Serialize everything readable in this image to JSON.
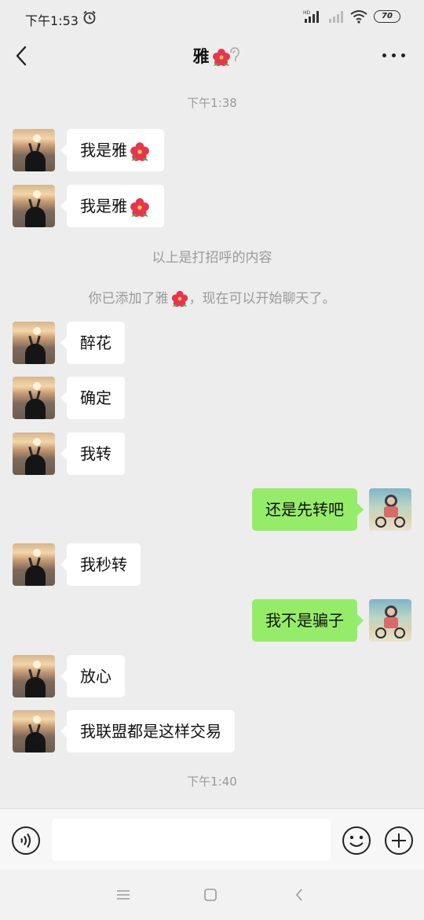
{
  "status_bar": {
    "time": "下午1:53",
    "battery": "70"
  },
  "header": {
    "title": "雅"
  },
  "timestamps": [
    "下午1:38",
    "下午1:40"
  ],
  "system_messages": [
    "以上是打招呼的内容",
    "你已添加了雅",
    "，现在可以开始聊天了。"
  ],
  "messages": [
    {
      "side": "left",
      "text": "我是雅"
    },
    {
      "side": "left",
      "text": "我是雅"
    },
    {
      "side": "left",
      "text": "醉花"
    },
    {
      "side": "left",
      "text": "确定"
    },
    {
      "side": "left",
      "text": "我转"
    },
    {
      "side": "right",
      "text": "还是先转吧"
    },
    {
      "side": "left",
      "text": "我秒转"
    },
    {
      "side": "right",
      "text": "我不是骗子"
    },
    {
      "side": "left",
      "text": "放心"
    },
    {
      "side": "left",
      "text": "我联盟都是这样交易"
    }
  ],
  "input": {
    "value": "",
    "placeholder": ""
  },
  "colors": {
    "background": "#ededed",
    "sent_bubble": "#95ec69",
    "received_bubble": "#ffffff"
  },
  "icons": [
    "alarm-icon",
    "signal-icon",
    "wifi-icon",
    "battery-icon",
    "back-arrow-icon",
    "ear-icon",
    "more-icon",
    "flower-emoji-icon",
    "voice-icon",
    "emoji-icon",
    "plus-icon",
    "menu-icon",
    "home-icon",
    "nav-back-icon"
  ]
}
